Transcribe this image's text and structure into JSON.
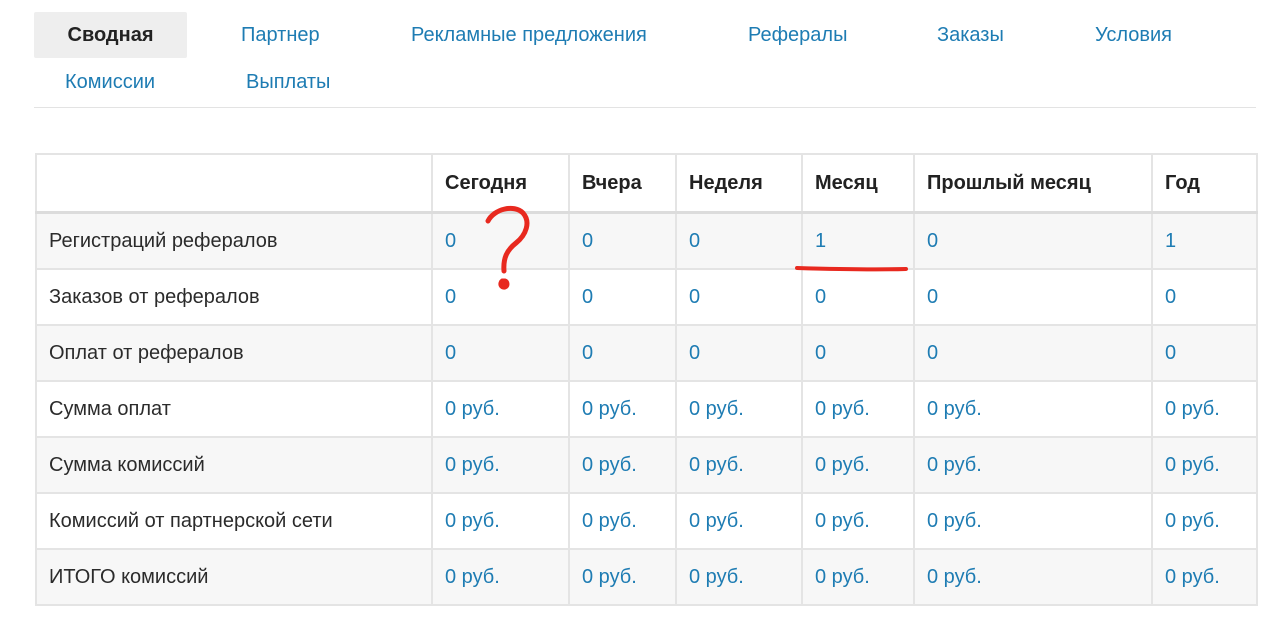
{
  "tabs": [
    {
      "label": "Сводная",
      "active": true
    },
    {
      "label": "Партнер"
    },
    {
      "label": "Рекламные предложения"
    },
    {
      "label": "Рефералы"
    },
    {
      "label": "Заказы"
    },
    {
      "label": "Условия"
    },
    {
      "label": "Комиссии"
    },
    {
      "label": "Выплаты"
    }
  ],
  "table": {
    "columns": [
      "",
      "Сегодня",
      "Вчера",
      "Неделя",
      "Месяц",
      "Прошлый месяц",
      "Год"
    ],
    "rows": [
      {
        "label": "Регистраций рефералов",
        "values": [
          "0",
          "0",
          "0",
          "1",
          "0",
          "1"
        ]
      },
      {
        "label": "Заказов от рефералов",
        "values": [
          "0",
          "0",
          "0",
          "0",
          "0",
          "0"
        ]
      },
      {
        "label": "Оплат от рефералов",
        "values": [
          "0",
          "0",
          "0",
          "0",
          "0",
          "0"
        ]
      },
      {
        "label": "Сумма оплат",
        "values": [
          "0 руб.",
          "0 руб.",
          "0 руб.",
          "0 руб.",
          "0 руб.",
          "0 руб."
        ]
      },
      {
        "label": "Сумма комиссий",
        "values": [
          "0 руб.",
          "0 руб.",
          "0 руб.",
          "0 руб.",
          "0 руб.",
          "0 руб."
        ]
      },
      {
        "label": "Комиссий от партнерской сети",
        "values": [
          "0 руб.",
          "0 руб.",
          "0 руб.",
          "0 руб.",
          "0 руб.",
          "0 руб."
        ]
      },
      {
        "label": "ИТОГО комиссий",
        "values": [
          "0 руб.",
          "0 руб.",
          "0 руб.",
          "0 руб.",
          "0 руб.",
          "0 руб."
        ]
      }
    ]
  },
  "colors": {
    "link": "#1e7cb3",
    "active_tab_bg": "#eeeeee",
    "annotation": "#e8291f"
  }
}
